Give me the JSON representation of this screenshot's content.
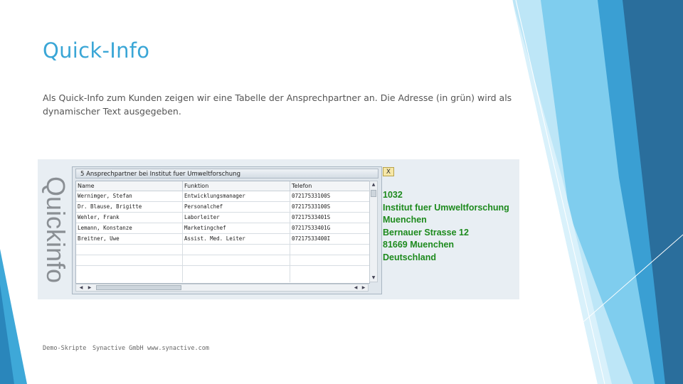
{
  "slide": {
    "title": "Quick-Info",
    "body": "Als Quick-Info zum Kunden zeigen wir eine Tabelle der Ansprechpartner an. Die Adresse (in grün) wird als dynamischer Text ausgegeben."
  },
  "screenshot": {
    "vertical_label": "Quickinfo",
    "window_title": "5 Ansprechpartner bei Institut fuer Umweltforschung",
    "columns": [
      "Name",
      "Funktion",
      "Telefon"
    ],
    "rows": [
      [
        "Wernimger, Stefan",
        "Entwicklungsmanager",
        "07217533100S"
      ],
      [
        "Dr. Blause, Brigitte",
        "Personalchef",
        "07217533100S"
      ],
      [
        "Wehler, Frank",
        "Laborleiter",
        "07217533401S"
      ],
      [
        "Lemann, Konstanze",
        "Marketingchef",
        "07217533401G"
      ],
      [
        "Breitner, Uwe",
        "Assist. Med. Leiter",
        "07217533400I"
      ]
    ],
    "close_label": "X",
    "address_lines": [
      "1032",
      "Institut fuer Umweltforschung",
      "Muenchen",
      "Bernauer Strasse 12",
      "81669 Muenchen",
      "Deutschland"
    ],
    "address_color": "#1d8a1d"
  },
  "footer": {
    "left": "Demo-Skripte",
    "middle": "Synactive GmbH",
    "right": "www.synactive.com"
  },
  "colors": {
    "title": "#3aa6d6",
    "accent_light": "#9fd9f1",
    "accent_dark": "#2a6e9c"
  }
}
